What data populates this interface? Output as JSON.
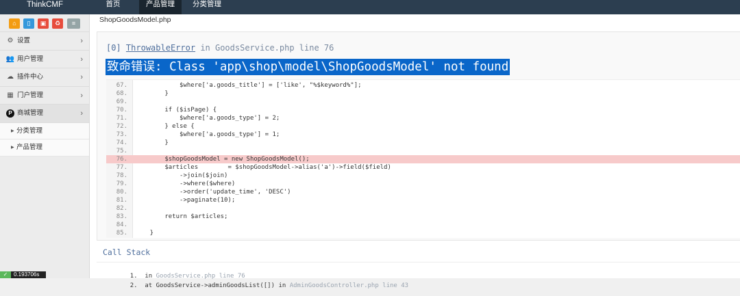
{
  "navbar": {
    "brand": "ThinkCMF",
    "items": [
      {
        "label": "首页",
        "active": false
      },
      {
        "label": "产品管理",
        "active": true
      },
      {
        "label": "分类管理",
        "active": false
      }
    ]
  },
  "sidebar": {
    "shortcuts": [
      {
        "icon": "home-icon",
        "glyph": "⌂",
        "color": "#f39c12"
      },
      {
        "icon": "file-icon",
        "glyph": "▯",
        "color": "#3498db"
      },
      {
        "icon": "trash-icon",
        "glyph": "▣",
        "color": "#e74c3c"
      },
      {
        "icon": "recycle-icon",
        "glyph": "♻",
        "color": "#e74c3c"
      },
      {
        "icon": "list-icon",
        "glyph": "≡",
        "color": "#95a5a6"
      }
    ],
    "menu": [
      {
        "label": "设置",
        "icon": "gears-icon",
        "glyph": "⚙"
      },
      {
        "label": "用户管理",
        "icon": "users-icon",
        "glyph": "👥"
      },
      {
        "label": "插件中心",
        "icon": "cloud-icon",
        "glyph": "☁"
      },
      {
        "label": "门户管理",
        "icon": "grid-icon",
        "glyph": "▦"
      },
      {
        "label": "商城管理",
        "icon": "p-icon",
        "glyph": "P"
      }
    ],
    "submenu": [
      {
        "label": "分类管理"
      },
      {
        "label": "产品管理"
      }
    ],
    "timer": "0.193706s"
  },
  "main": {
    "filename": "ShopGoodsModel.php",
    "exception": {
      "index": "[0]",
      "class": "ThrowableError",
      "location": "in GoodsService.php line 76",
      "message": "致命错误: Class 'app\\shop\\model\\ShopGoodsModel' not found"
    },
    "code_lines": [
      {
        "n": "67.",
        "code": "            $where['a.goods_title'] = ['like', \"%$keyword%\"];",
        "hl": false
      },
      {
        "n": "68.",
        "code": "        }",
        "hl": false
      },
      {
        "n": "69.",
        "code": "",
        "hl": false
      },
      {
        "n": "70.",
        "code": "        if ($isPage) {",
        "hl": false
      },
      {
        "n": "71.",
        "code": "            $where['a.goods_type'] = 2;",
        "hl": false
      },
      {
        "n": "72.",
        "code": "        } else {",
        "hl": false
      },
      {
        "n": "73.",
        "code": "            $where['a.goods_type'] = 1;",
        "hl": false
      },
      {
        "n": "74.",
        "code": "        }",
        "hl": false
      },
      {
        "n": "75.",
        "code": "",
        "hl": false
      },
      {
        "n": "76.",
        "code": "        $shopGoodsModel = new ShopGoodsModel();",
        "hl": true
      },
      {
        "n": "77.",
        "code": "        $articles        = $shopGoodsModel->alias('a')->field($field)",
        "hl": false
      },
      {
        "n": "78.",
        "code": "            ->join($join)",
        "hl": false
      },
      {
        "n": "79.",
        "code": "            ->where($where)",
        "hl": false
      },
      {
        "n": "80.",
        "code": "            ->order('update_time', 'DESC')",
        "hl": false
      },
      {
        "n": "81.",
        "code": "            ->paginate(10);",
        "hl": false
      },
      {
        "n": "82.",
        "code": "",
        "hl": false
      },
      {
        "n": "83.",
        "code": "        return $articles;",
        "hl": false
      },
      {
        "n": "84.",
        "code": "",
        "hl": false
      },
      {
        "n": "85.",
        "code": "    }",
        "hl": false
      }
    ],
    "callstack": {
      "title": "Call Stack",
      "items": [
        {
          "n": "1.",
          "text": "in",
          "file": "GoodsService.php line 76"
        },
        {
          "n": "2.",
          "text": "at GoodsService->adminGoodsList([]) in",
          "file": "AdminGoodsController.php line 43"
        }
      ]
    }
  }
}
